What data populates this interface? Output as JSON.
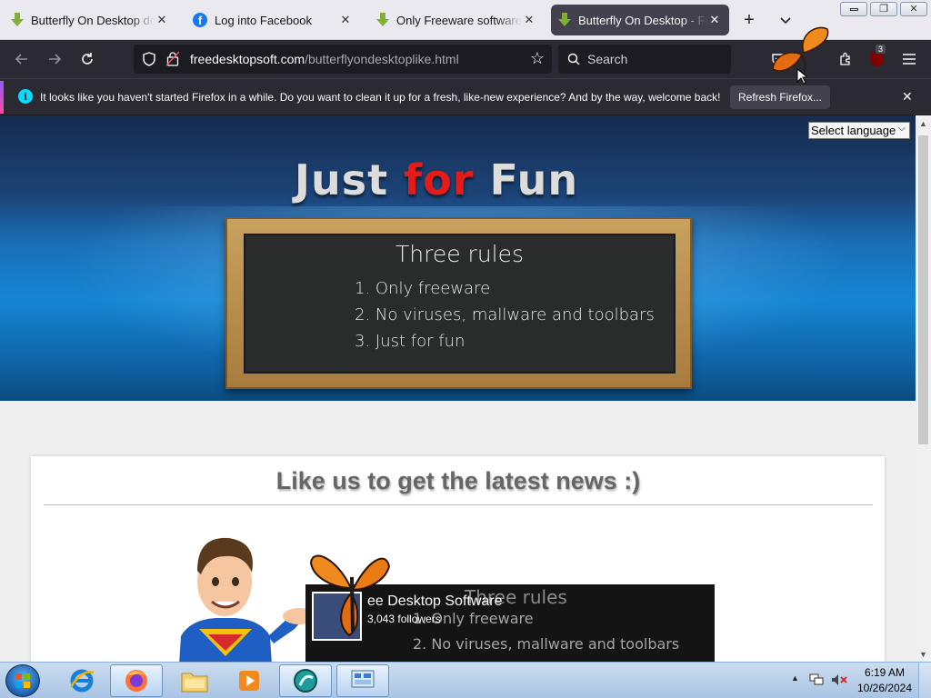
{
  "tabs": [
    {
      "title": "Butterfly On Desktop download",
      "favicon": "download-icon",
      "active": false
    },
    {
      "title": "Log into Facebook",
      "favicon": "facebook-icon",
      "active": false
    },
    {
      "title": "Only Freeware software for",
      "favicon": "download-icon",
      "active": false
    },
    {
      "title": "Butterfly On Desktop - Free",
      "favicon": "download-icon",
      "active": true
    }
  ],
  "tabstrip": {
    "new_tab": "+",
    "list_all": "⌵"
  },
  "window": {
    "minimize": "▭",
    "restore": "❐",
    "close": "✕"
  },
  "nav": {
    "url_host": "freedesktopsoft.com",
    "url_path": "/butterflyondesktoplike.html",
    "search_placeholder": "Search",
    "extension_badge": "3"
  },
  "notification": {
    "text": "It looks like you haven't started Firefox in a while. Do you want to clean it up for a fresh, like-new experience? And by the way, welcome back!",
    "button": "Refresh Firefox...",
    "close": "✕"
  },
  "page": {
    "language_select": "Select language",
    "hero_title_1": "Just",
    "hero_title_2": "for",
    "hero_title_3": "Fun",
    "board_title": "Three rules",
    "rules": [
      "1. Only freeware",
      "2. No viruses, mallware and toolbars",
      "3. Just for fun"
    ],
    "like_heading": "Like us to get the latest news :)",
    "fb_board_title": "Three rules",
    "fb_rules": [
      "1. Only freeware",
      "2. No viruses, mallware and toolbars"
    ],
    "fb_page_name": "ee Desktop Software",
    "fb_followers": "3,043 followers"
  },
  "taskbar": {
    "time": "6:19 AM",
    "date": "10/26/2024",
    "apps": [
      "internet-explorer",
      "firefox",
      "file-explorer",
      "media-player",
      "app-circle",
      "control-panel"
    ]
  },
  "colors": {
    "accent_red": "#e41b17",
    "firefox_dark": "#2b2a33",
    "hero_blue": "#1585d3"
  }
}
